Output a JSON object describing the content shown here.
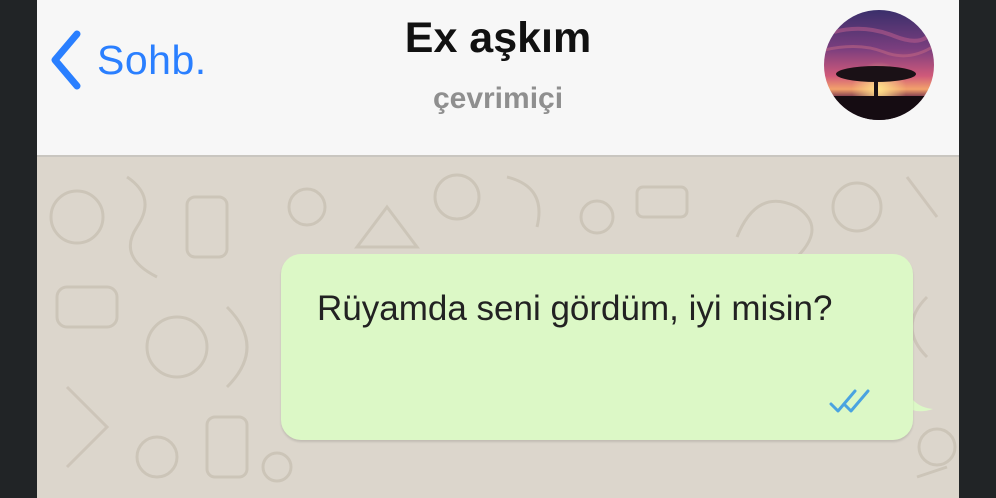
{
  "header": {
    "back_label": "Sohb.",
    "contact_name": "Ex aşkım",
    "status": "çevrimiçi"
  },
  "messages": [
    {
      "text": "Rüyamda seni gördüm, iyi misin?",
      "direction": "outgoing",
      "read_status": "double-check-read"
    }
  ],
  "colors": {
    "accent": "#2a7fff",
    "outgoing_bubble": "#dcf8c6",
    "chat_background": "#dcd6cc",
    "read_ticks": "#4aa3e0"
  },
  "icons": {
    "back": "chevron-left-icon",
    "read": "double-check-icon"
  }
}
